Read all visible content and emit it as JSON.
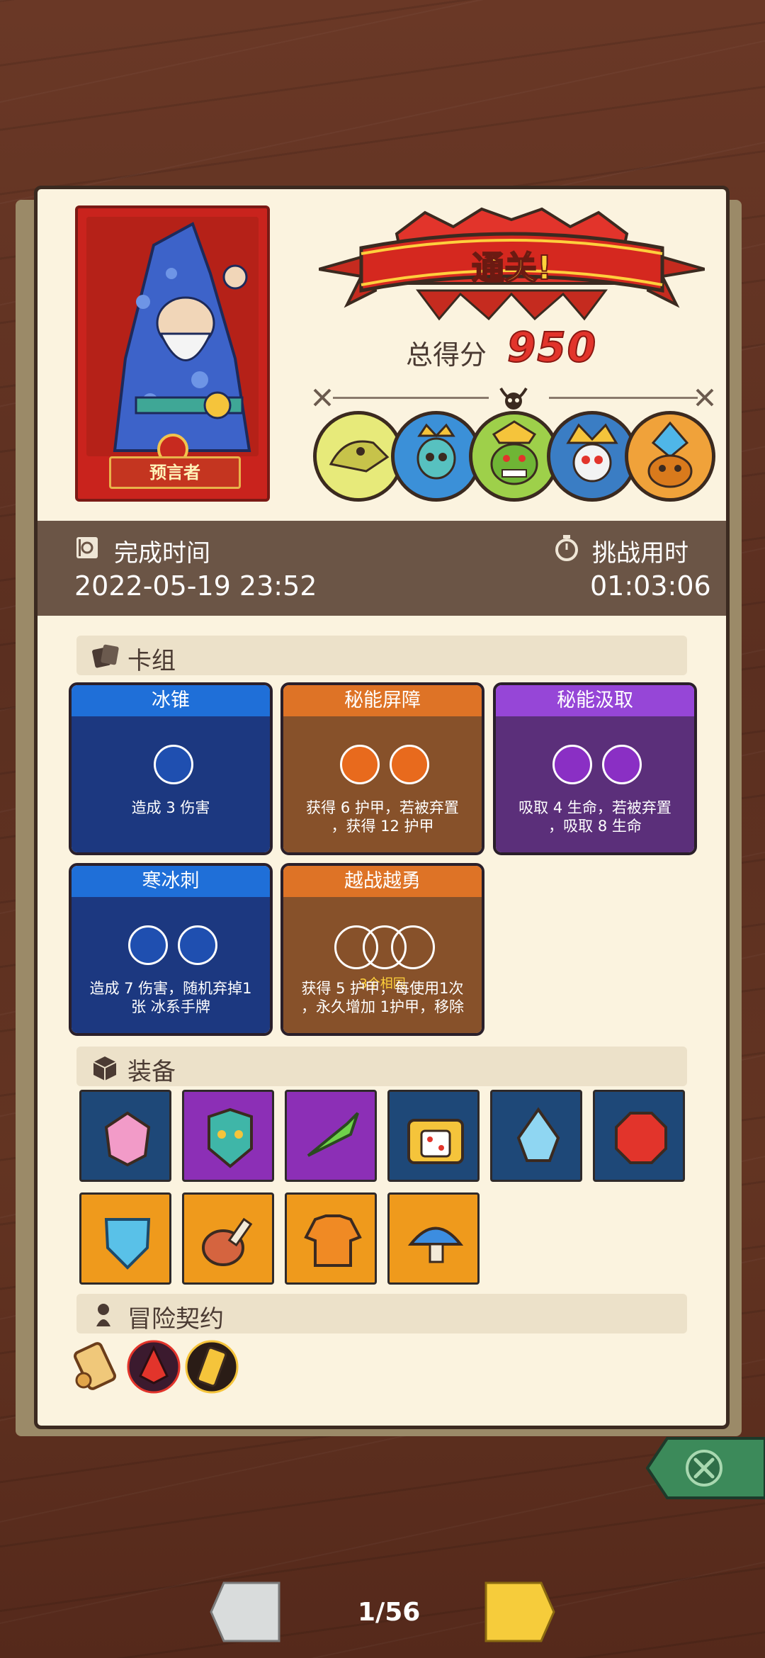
{
  "result": {
    "banner_text": "通关!",
    "score_label": "总得分",
    "score_value": "950"
  },
  "hero": {
    "name": "预言者"
  },
  "bosses": [
    "dino-skeleton-boss",
    "crowned-skull-boss",
    "green-goblin-king-boss",
    "feathered-skull-boss",
    "crystal-golem-boss"
  ],
  "time": {
    "completion_label": "完成时间",
    "completion_value": "2022-05-19 23:52",
    "challenge_label": "挑战用时",
    "challenge_value": "01:03:06"
  },
  "deck": {
    "section_title": "卡组",
    "cards": [
      {
        "title": "冰锥",
        "color": "blue",
        "desc": [
          "造成 3 伤害"
        ]
      },
      {
        "title": "秘能屏障",
        "color": "orange",
        "desc": [
          "获得 6 护甲，若被弃置",
          "，获得 12 护甲"
        ]
      },
      {
        "title": "秘能汲取",
        "color": "purple",
        "desc": [
          "吸取 4 生命，若被弃置",
          "，吸取 8 生命"
        ]
      },
      {
        "title": "寒冰刺",
        "color": "blue",
        "desc": [
          "造成 7 伤害，随机弃掉1",
          "张 冰系手牌"
        ]
      },
      {
        "title": "越战越勇",
        "color": "orange",
        "orb_note": "3个相同",
        "desc": [
          "获得 5 护甲，每使用1次",
          "，永久增加 1护甲，移除"
        ]
      }
    ]
  },
  "equipment": {
    "section_title": "装备",
    "items": [
      "pink-gem-icon",
      "demon-mask-icon",
      "green-leaf-dagger-icon",
      "dice-chest-icon",
      "water-drop-gem-icon",
      "red-ruby-icon",
      "ice-shield-icon",
      "meat-leg-icon",
      "orange-sweater-icon",
      "blue-mushroom-icon"
    ]
  },
  "contract": {
    "section_title": "冒险契约",
    "items": [
      "scroll-icon",
      "red-flame-mask-icon",
      "golden-totem-icon"
    ]
  },
  "pager": {
    "text": "1/56"
  },
  "colors": {
    "score_red": "#e2342b",
    "card_blue": "#1f6fd8",
    "card_orange": "#de7326",
    "card_purple": "#9646d7",
    "highlight_yellow": "#ffd23a"
  }
}
